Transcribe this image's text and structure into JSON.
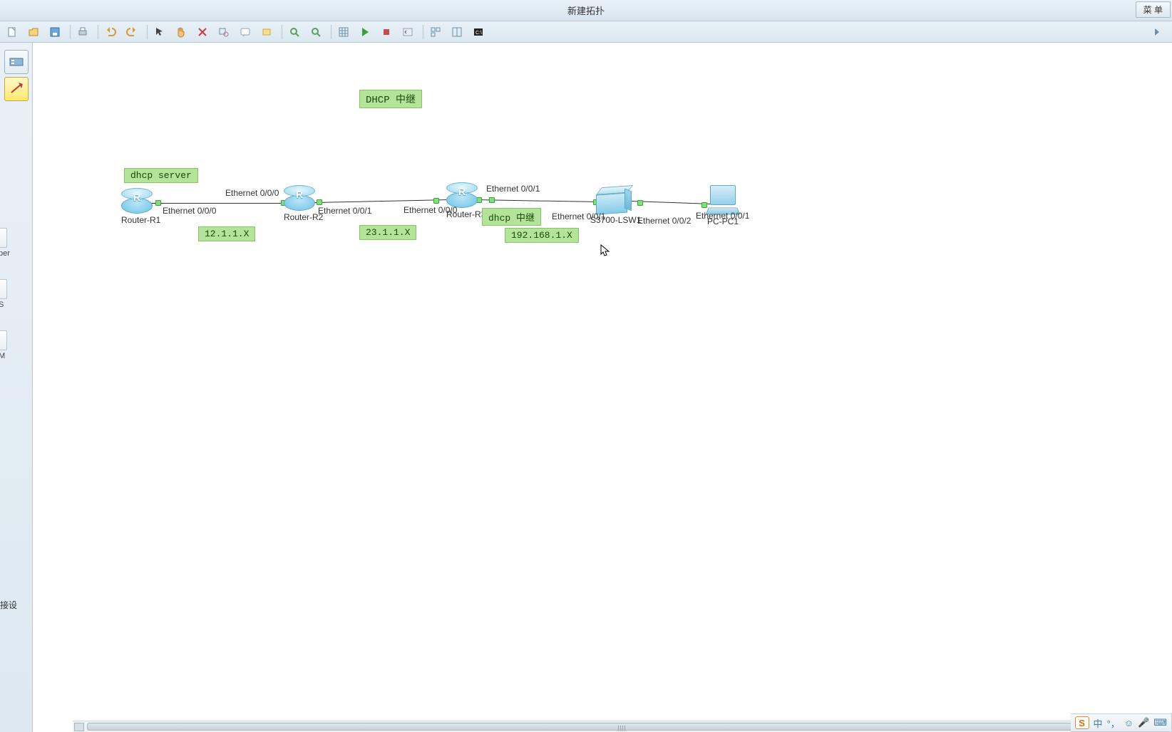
{
  "window": {
    "title": "新建拓扑",
    "menu_button": "菜  单"
  },
  "toolbar": {
    "new": "新建",
    "open": "打开",
    "save": "保存",
    "print": "打印",
    "undo": "撤销",
    "redo": "重做",
    "select": "选择",
    "pan": "平移",
    "delete": "删除",
    "capture": "捕获",
    "note": "文本",
    "rect": "矩形",
    "zoom_in": "放大",
    "zoom_out": "缩小",
    "grid": "网格",
    "start": "启动",
    "stop": "停止",
    "cli": "CLI",
    "arrange": "排列",
    "tile": "平铺",
    "cmd": "命令行"
  },
  "palette": {
    "item1": "设备",
    "item2": "连接"
  },
  "sidebar_labels": {
    "per": "per",
    "s": "S",
    "m": "M",
    "conn": "接设"
  },
  "topology": {
    "title_tag": "DHCP 中继",
    "server_tag": "dhcp server",
    "relay_tag": "dhcp 中继",
    "subnet1": "12.1.1.X",
    "subnet2": "23.1.1.X",
    "subnet3": "192.168.1.X",
    "devices": {
      "r1": {
        "label": "Router-R1",
        "type": "router"
      },
      "r2": {
        "label": "Router-R2",
        "type": "router"
      },
      "r3": {
        "label": "Router-R3",
        "type": "router"
      },
      "sw1": {
        "label": "S3700-LSW1",
        "type": "switch"
      },
      "pc1": {
        "label": "PC-PC1",
        "type": "pc"
      }
    },
    "interfaces": {
      "r1_e000": "Ethernet 0/0/0",
      "r2_e000": "Ethernet 0/0/0",
      "r2_e001": "Ethernet 0/0/1",
      "r3_e000": "Ethernet 0/0/0",
      "r3_e001_top": "Ethernet 0/0/1",
      "r3_e001": "Ethernet 0/0/1",
      "sw_e002": "Ethernet 0/0/2",
      "pc_e001": "Ethernet 0/0/1"
    }
  },
  "ime": {
    "badge": "S",
    "lang": "中",
    "punct": "°，",
    "face": "☺",
    "mic": "🎤",
    "kb": "⌨"
  }
}
